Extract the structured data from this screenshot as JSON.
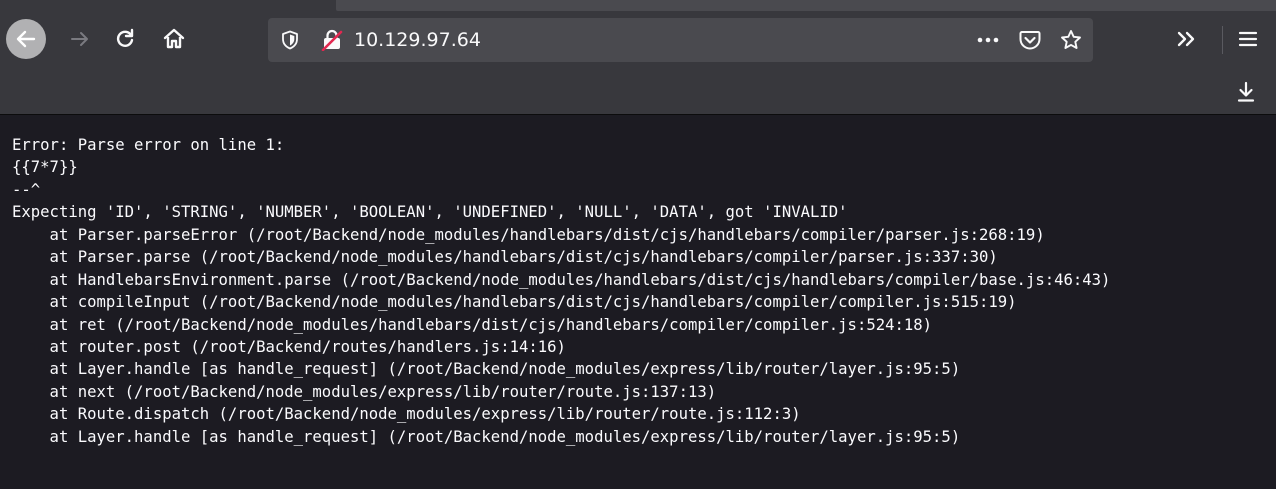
{
  "browser": {
    "address": "10.129.97.64",
    "icons": {
      "back": "arrow-left-icon",
      "forward": "arrow-right-icon",
      "reload": "reload-icon",
      "home": "home-icon",
      "tracking_protection": "shield-icon",
      "insecure_connection": "insecure-lock-icon",
      "page_actions": "more-icon",
      "pocket": "pocket-icon",
      "bookmark": "star-icon",
      "overflow": "chevron-double-right-icon",
      "menu": "hamburger-icon",
      "downloads": "download-icon"
    },
    "colors": {
      "toolbar": "#38383d",
      "urlbar": "#4a4a4f",
      "content_bg": "#1c1b22",
      "text": "#fbfbfe"
    }
  },
  "page": {
    "error_lines": [
      "Error: Parse error on line 1:",
      "{{7*7}}",
      "--^",
      "Expecting 'ID', 'STRING', 'NUMBER', 'BOOLEAN', 'UNDEFINED', 'NULL', 'DATA', got 'INVALID'",
      "    at Parser.parseError (/root/Backend/node_modules/handlebars/dist/cjs/handlebars/compiler/parser.js:268:19)",
      "    at Parser.parse (/root/Backend/node_modules/handlebars/dist/cjs/handlebars/compiler/parser.js:337:30)",
      "    at HandlebarsEnvironment.parse (/root/Backend/node_modules/handlebars/dist/cjs/handlebars/compiler/base.js:46:43)",
      "    at compileInput (/root/Backend/node_modules/handlebars/dist/cjs/handlebars/compiler/compiler.js:515:19)",
      "    at ret (/root/Backend/node_modules/handlebars/dist/cjs/handlebars/compiler/compiler.js:524:18)",
      "    at router.post (/root/Backend/routes/handlers.js:14:16)",
      "    at Layer.handle [as handle_request] (/root/Backend/node_modules/express/lib/router/layer.js:95:5)",
      "    at next (/root/Backend/node_modules/express/lib/router/route.js:137:13)",
      "    at Route.dispatch (/root/Backend/node_modules/express/lib/router/route.js:112:3)",
      "    at Layer.handle [as handle_request] (/root/Backend/node_modules/express/lib/router/layer.js:95:5)"
    ]
  }
}
